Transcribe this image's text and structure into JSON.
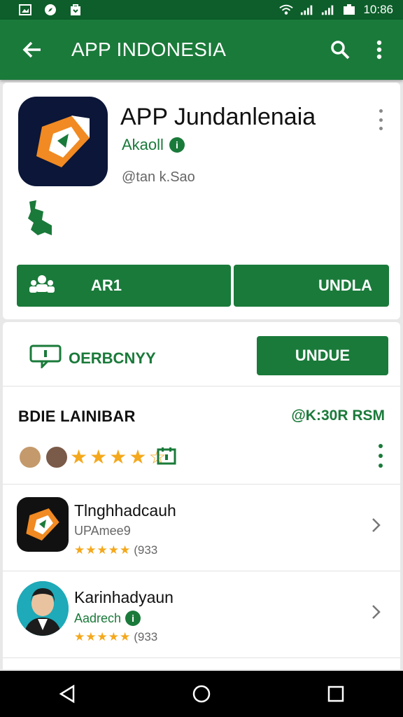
{
  "status_bar": {
    "time": "10:86"
  },
  "app_bar": {
    "title": "APP INDONESIA"
  },
  "app": {
    "name": "APP Jundanlenaia",
    "developer": "Akaoll",
    "developer_badge": "i",
    "subtitle": "@tan k.Sao",
    "primary_button": "AR1",
    "secondary_button": "UNDLA"
  },
  "action_row": {
    "comment_label": "OERBCNYY",
    "button": "UNDUE"
  },
  "section": {
    "title": "BDIE LAINIBAR",
    "right_label": "@K:30R RSM",
    "stars": [
      "★",
      "★",
      "★",
      "★",
      "☆"
    ]
  },
  "list": [
    {
      "name": "Tlnghhadcauh",
      "sub": "UPAmee9",
      "stars": "★★★★★",
      "count": "(933"
    },
    {
      "name": "Karinhadyaun",
      "sub": "Aadrech",
      "badge": "i",
      "stars": "★★★★★",
      "count": "(933"
    }
  ],
  "colors": {
    "primary": "#1a7a3a",
    "status_bar": "#0d5e2a",
    "star": "#f4a81c"
  }
}
